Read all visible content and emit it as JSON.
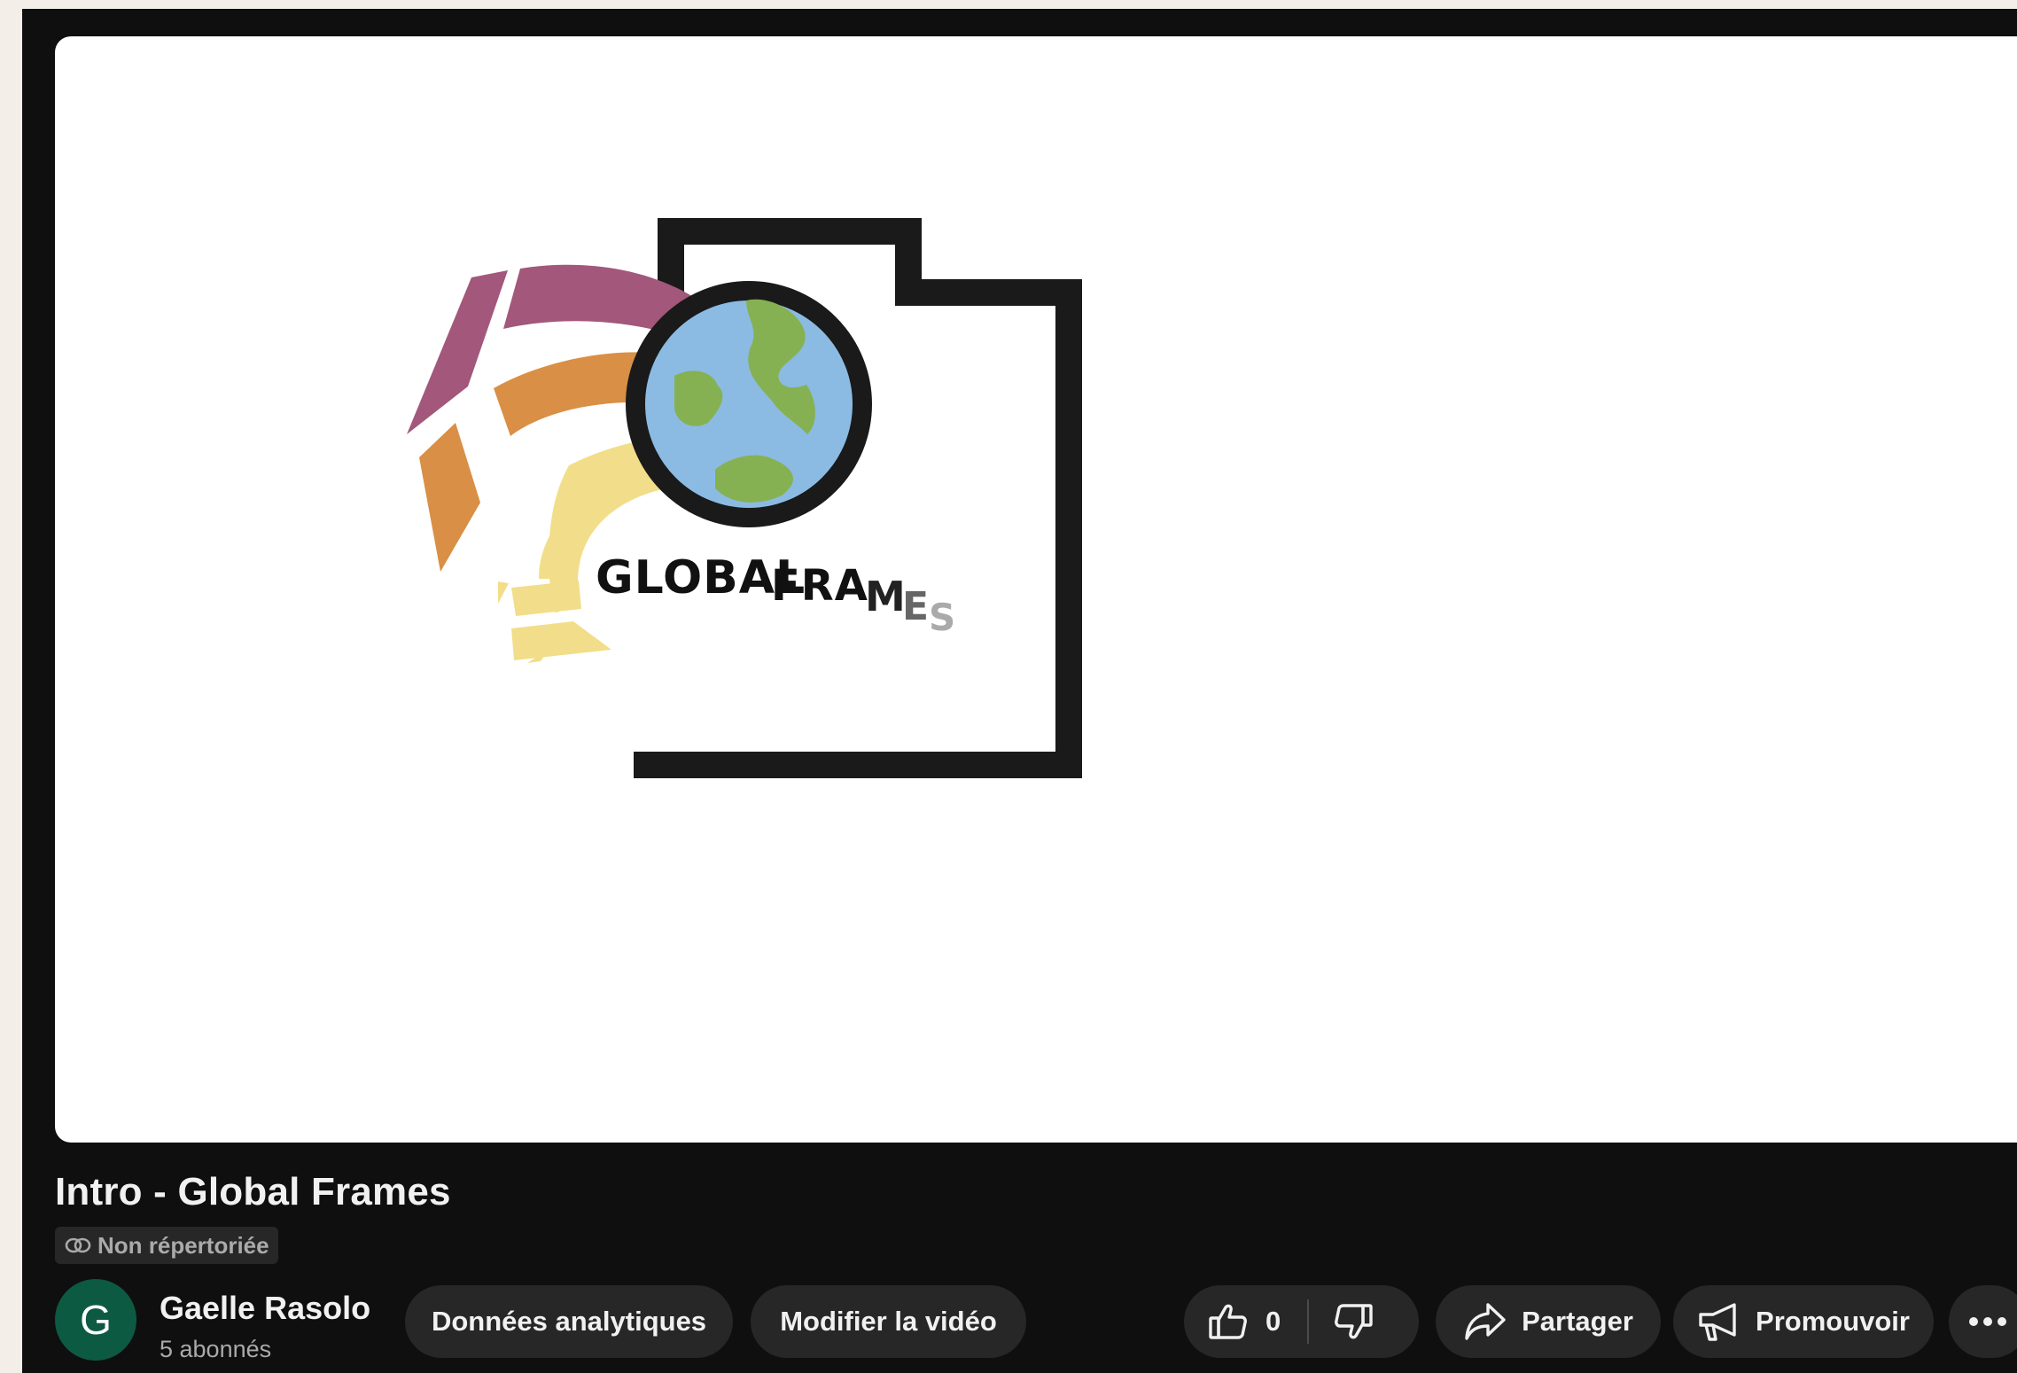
{
  "video": {
    "title": "Intro - Global Frames",
    "visibility": "Non répertoriée",
    "thumbnail_logo_text": "GLOBAL FRAMES"
  },
  "channel": {
    "avatar_letter": "G",
    "avatar_color": "#0d5a43",
    "name": "Gaelle Rasolo",
    "subscribers": "5 abonnés"
  },
  "actions": {
    "analytics_label": "Données analytiques",
    "edit_label": "Modifier la vidéo",
    "like_count": "0",
    "share_label": "Partager",
    "promote_label": "Promouvoir"
  },
  "colors": {
    "app_background": "#0f0f0f",
    "pill_background": "#272727",
    "text_primary": "#f1f1f1",
    "text_secondary": "#aaaaaa",
    "logo_purple": "#a2577b",
    "logo_orange": "#d98f45",
    "logo_yellow": "#f2de8a",
    "globe_water": "#8bbbe3",
    "globe_land": "#86b152"
  },
  "icons": [
    "link-icon",
    "thumbs-up-icon",
    "thumbs-down-icon",
    "share-icon",
    "megaphone-icon",
    "more-icon"
  ]
}
